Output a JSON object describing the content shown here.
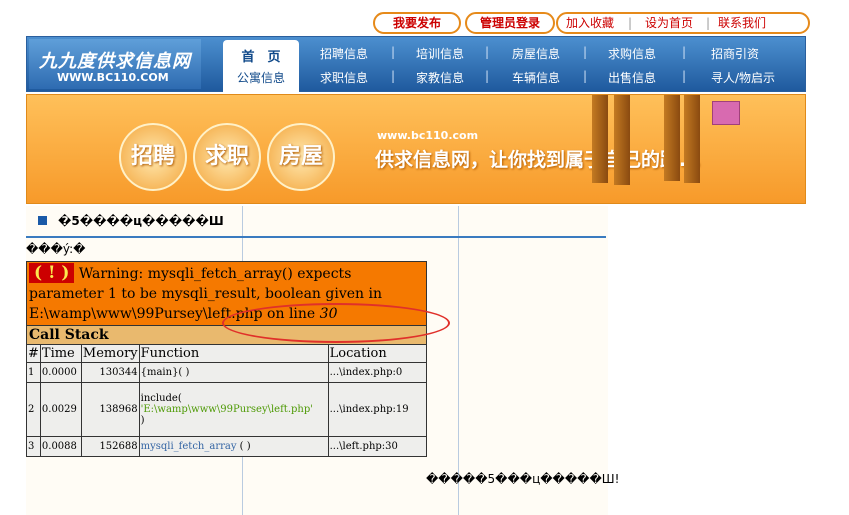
{
  "top": {
    "publish": "我要发布",
    "admin_login": "管理员登录",
    "links": [
      "加入收藏",
      "设为首页",
      "联系我们"
    ]
  },
  "logo": {
    "name": "九九度供求信息网",
    "url": "WWW.BC110.COM"
  },
  "nav": {
    "active_top": "首　页",
    "active_bottom": "公寓信息",
    "row1": [
      "招聘信息",
      "培训信息",
      "房屋信息",
      "求购信息",
      "招商引资"
    ],
    "row2": [
      "求职信息",
      "家教信息",
      "车辆信息",
      "出售信息",
      "寻人/物启示"
    ]
  },
  "banner": {
    "circles": [
      "招聘",
      "求职",
      "房屋"
    ],
    "url": "www.bc110.com",
    "slogan": "供求信息网，让你找到属于自己的路..."
  },
  "section": {
    "title": "�5����ц�����Ш",
    "garbled_line": "���ý:�",
    "garbled_footer": "�����5���ц�����Ш!"
  },
  "error": {
    "bang": "( ! )",
    "message_pre": "Warning: mysqli_fetch_array() expects parameter 1 to be mysqli_result, boolean given in E:\\wamp\\www\\99Pursey\\left.php on line ",
    "line": "30",
    "call_stack": "Call Stack",
    "columns": [
      "#",
      "Time",
      "Memory",
      "Function",
      "Location"
    ],
    "rows": [
      {
        "n": "1",
        "time": "0.0000",
        "memory": "130344",
        "func": "{main}( )",
        "func_arg": "",
        "func_end": "",
        "location": "...\\index.php:0"
      },
      {
        "n": "2",
        "time": "0.0029",
        "memory": "138968",
        "func": "include(",
        "func_arg": "'E:\\wamp\\www\\99Pursey\\left.php'",
        "func_end": ")",
        "location": "...\\index.php:19"
      },
      {
        "n": "3",
        "time": "0.0088",
        "memory": "152688",
        "func": "mysqli_fetch_array",
        "func_arg": "",
        "func_end": " ( )",
        "location": "...\\left.php:30"
      }
    ]
  },
  "colors": {
    "error_bg": "#f57900",
    "callstack_bg": "#e9b96e",
    "nav_blue": "#1f5a9e",
    "annotation_red": "#e0302a"
  }
}
